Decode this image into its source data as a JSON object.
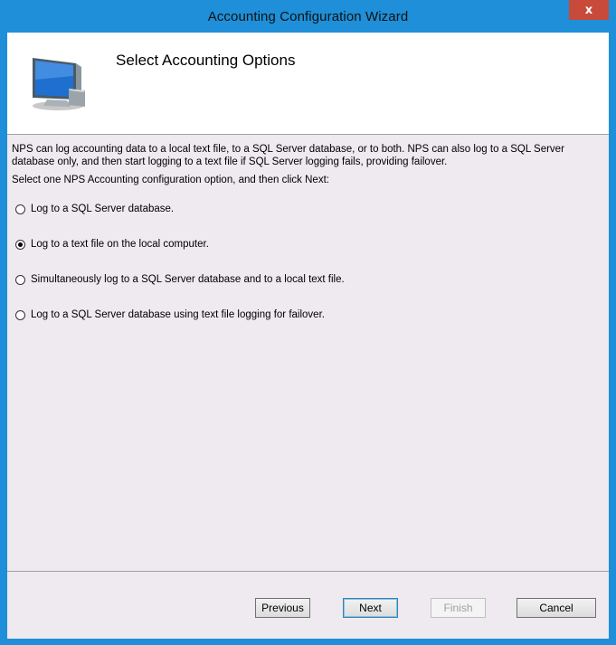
{
  "window": {
    "title": "Accounting Configuration Wizard",
    "close_glyph": "x"
  },
  "header": {
    "title": "Select Accounting Options",
    "icon": "computer-monitor-icon"
  },
  "body": {
    "description": "NPS can log accounting data to a local text file, to a SQL Server database, or to both. NPS can also log to a SQL Server database only, and then start logging to a text file if SQL Server logging fails, providing failover.",
    "prompt": "Select one NPS Accounting configuration option, and then click Next:",
    "options": [
      {
        "label": "Log to a SQL Server database.",
        "checked": false
      },
      {
        "label": "Log to a text file on the local computer.",
        "checked": true
      },
      {
        "label": "Simultaneously log to a SQL Server database and to a local text file.",
        "checked": false
      },
      {
        "label": "Log to a SQL Server database using text file logging for failover.",
        "checked": false
      }
    ]
  },
  "footer": {
    "previous_label": "Previous",
    "next_label": "Next",
    "finish_label": "Finish",
    "cancel_label": "Cancel"
  },
  "colors": {
    "frame": "#1e8fd8",
    "close_button": "#c74a3a",
    "panel": "#eeeaef"
  }
}
